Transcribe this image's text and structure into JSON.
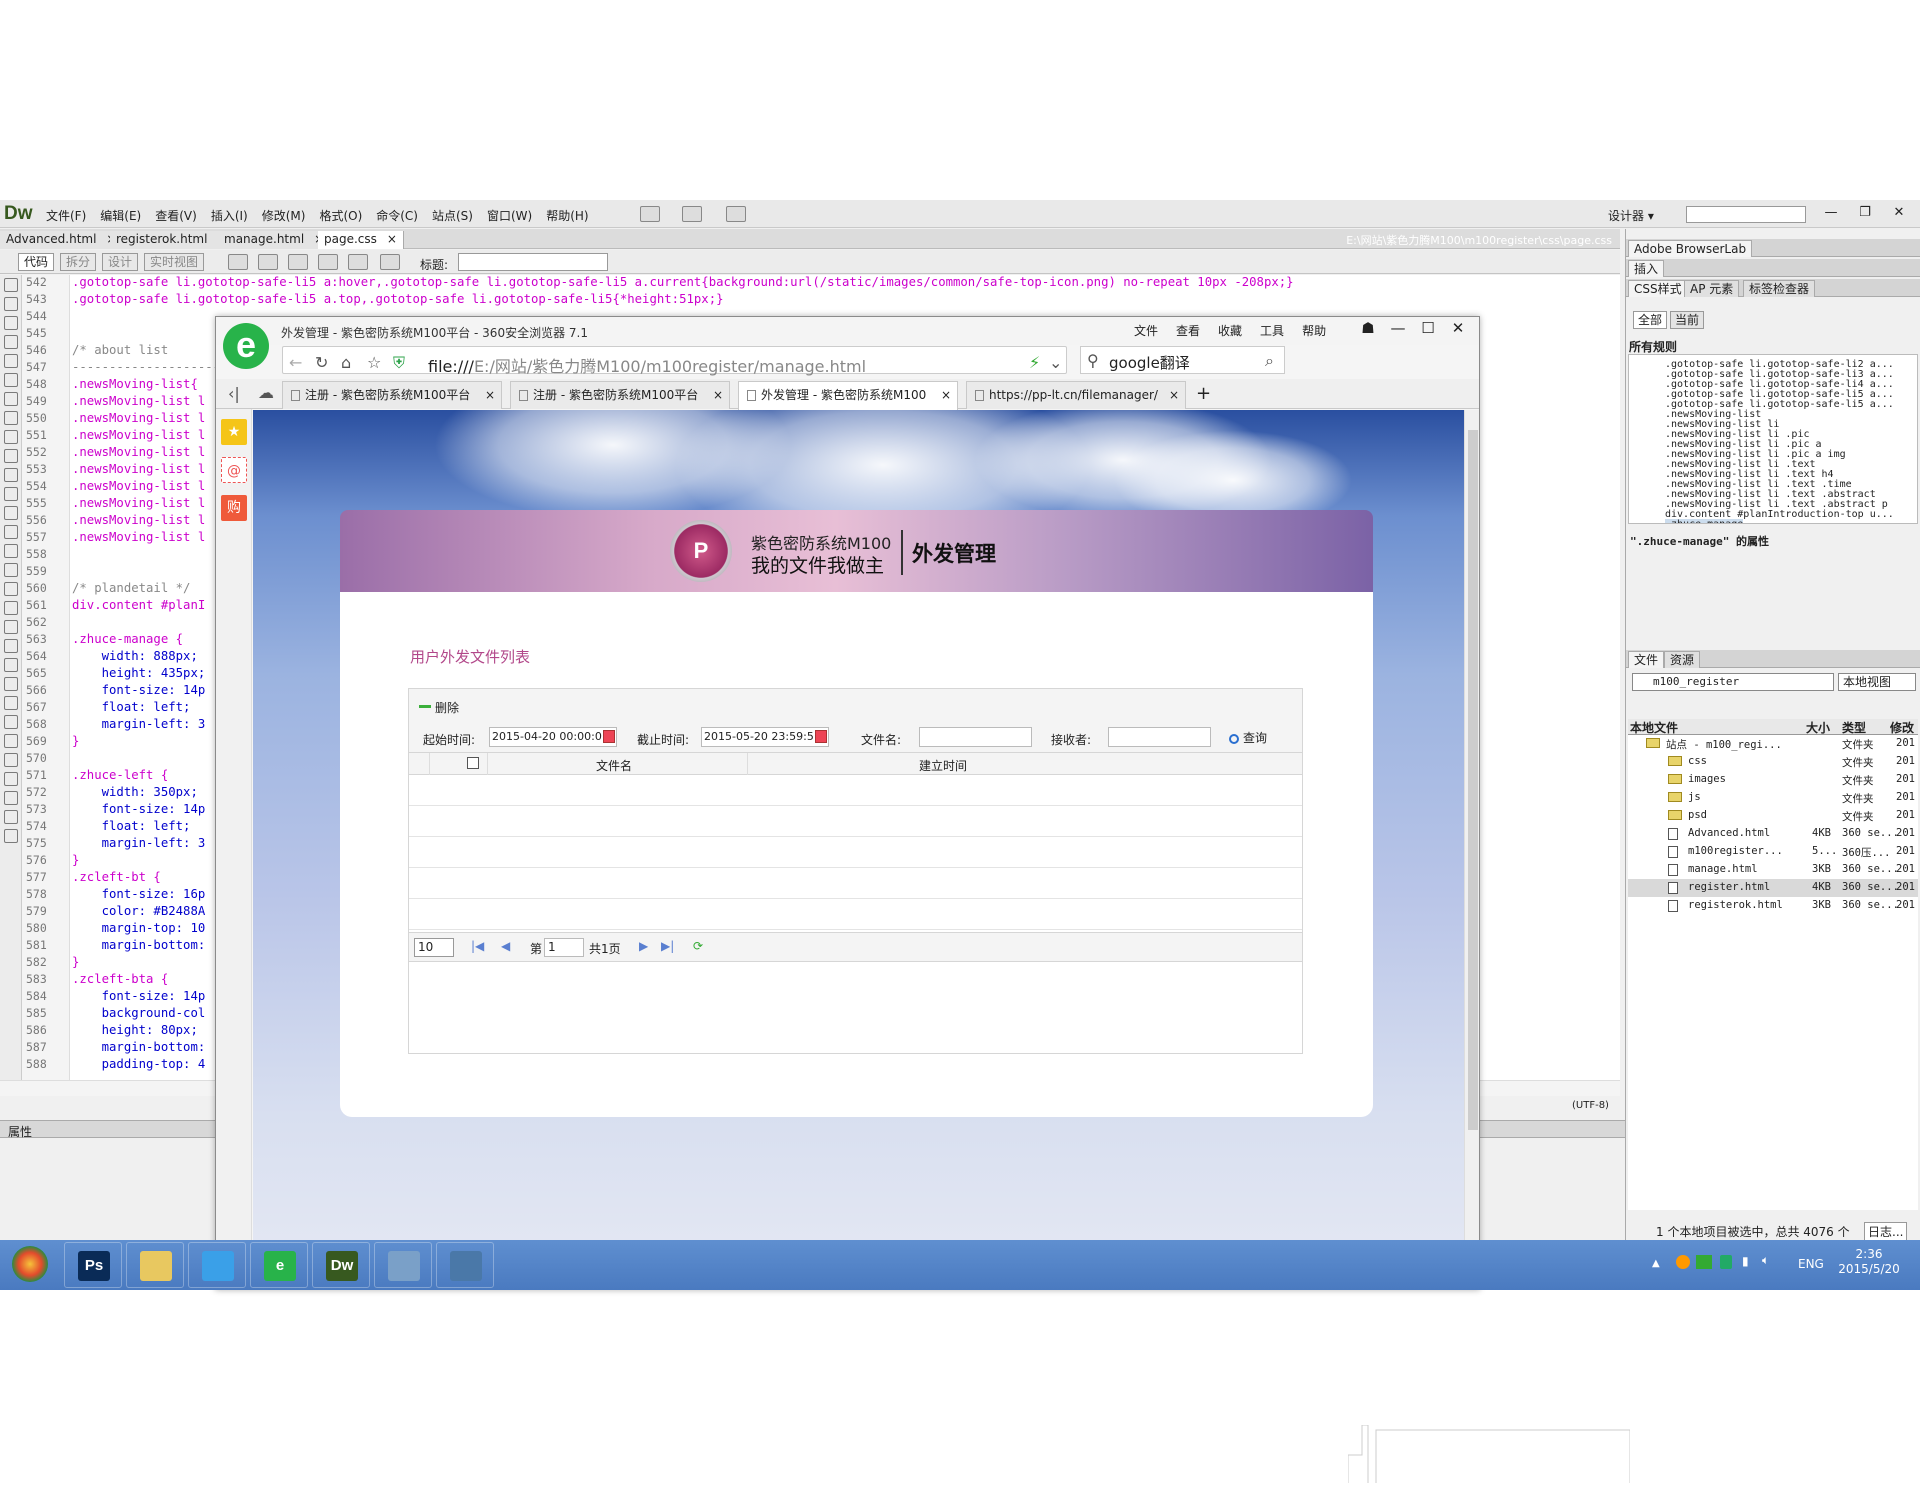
{
  "dw": {
    "logo": "Dw",
    "menus": [
      "文件(F)",
      "编辑(E)",
      "查看(V)",
      "插入(I)",
      "修改(M)",
      "格式(O)",
      "命令(C)",
      "站点(S)",
      "窗口(W)",
      "帮助(H)"
    ],
    "designer_label": "设计器 ▾",
    "doc_tabs": [
      "Advanced.html",
      "registerok.html",
      "manage.html",
      "page.css"
    ],
    "doc_close": "×",
    "path": "E:\\网站\\紫色力腾M100\\m100register\\css\\page.css",
    "view_buttons": [
      "代码",
      "拆分",
      "设计",
      "实时视图"
    ],
    "title_label": "标题:",
    "line_numbers": [
      "542",
      "543",
      "544",
      "545",
      "546",
      "547",
      "548",
      "549",
      "550",
      "551",
      "552",
      "553",
      "554",
      "555",
      "556",
      "557",
      "558",
      "559",
      "560",
      "561",
      "562",
      "563",
      "564",
      "565",
      "566",
      "567",
      "568",
      "569",
      "570",
      "571",
      "572",
      "573",
      "574",
      "575",
      "576",
      "577",
      "578",
      "579",
      "580",
      "581",
      "582",
      "583",
      "584",
      "585",
      "586",
      "587",
      "588"
    ],
    "code": [
      ".gototop-safe li.gototop-safe-li5 a:hover,.gototop-safe li.gototop-safe-li5 a.current{background:url(/static/images/common/safe-top-icon.png) no-repeat 10px -208px;}",
      ".gototop-safe li.gototop-safe-li5 a.top,.gototop-safe li.gototop-safe-li5{*height:51px;}",
      "",
      "",
      "/* about list",
      "------------------------",
      ".newsMoving-list{",
      ".newsMoving-list l",
      ".newsMoving-list l",
      ".newsMoving-list l",
      ".newsMoving-list l",
      ".newsMoving-list l",
      ".newsMoving-list l",
      ".newsMoving-list l",
      ".newsMoving-list l",
      ".newsMoving-list l",
      "",
      "",
      "/* plandetail */",
      "div.content #planI",
      "",
      ".zhuce-manage {",
      "    width: 888px;",
      "    height: 435px;",
      "    font-size: 14p",
      "    float: left;",
      "    margin-left: 3",
      "}",
      "",
      ".zhuce-left {",
      "    width: 350px;",
      "    font-size: 14p",
      "    float: left;",
      "    margin-left: 3",
      "}",
      ".zcleft-bt {",
      "    font-size: 16p",
      "    color: #B2488A",
      "    margin-top: 10",
      "    margin-bottom:",
      "}",
      ".zcleft-bta {",
      "    font-size: 14p",
      "    background-col",
      "    height: 80px;",
      "    margin-bottom:",
      "    padding-top: 4"
    ],
    "props_label": "属性",
    "encoding": "(UTF-8)"
  },
  "right_panel": {
    "browserlab": "Adobe BrowserLab",
    "insert_tab": "插入",
    "css_tabs": [
      "CSS样式",
      "AP 元素",
      "标签检查器"
    ],
    "btn_all": "全部",
    "btn_current": "当前",
    "all_rules": "所有规则",
    "rules": [
      ".gototop-safe li.gototop-safe-li2 a...",
      ".gototop-safe li.gototop-safe-li3 a...",
      ".gototop-safe li.gototop-safe-li4 a...",
      ".gototop-safe li.gototop-safe-li5 a...",
      ".gototop-safe li.gototop-safe-li5 a...",
      ".newsMoving-list",
      ".newsMoving-list li",
      ".newsMoving-list li .pic",
      ".newsMoving-list li .pic a",
      ".newsMoving-list li .pic a img",
      ".newsMoving-list li .text",
      ".newsMoving-list li .text h4",
      ".newsMoving-list li .text .time",
      ".newsMoving-list li .text .abstract",
      ".newsMoving-list li .text .abstract p",
      "div.content #planIntroduction-top u...",
      ".zhuce-manage"
    ],
    "props_of": "\".zhuce-manage\" 的属性",
    "files_tabs": [
      "文件",
      "资源"
    ],
    "site_name": "m100_register",
    "view_mode": "本地视图",
    "files_columns": [
      "本地文件",
      "大小",
      "类型",
      "修改"
    ],
    "files": [
      {
        "name": "站点 - m100_regi...",
        "size": "",
        "type": "文件夹",
        "mod": "201",
        "kind": "folder",
        "indent": 0
      },
      {
        "name": "css",
        "size": "",
        "type": "文件夹",
        "mod": "201",
        "kind": "folder",
        "indent": 1
      },
      {
        "name": "images",
        "size": "",
        "type": "文件夹",
        "mod": "201",
        "kind": "folder",
        "indent": 1
      },
      {
        "name": "js",
        "size": "",
        "type": "文件夹",
        "mod": "201",
        "kind": "folder",
        "indent": 1
      },
      {
        "name": "psd",
        "size": "",
        "type": "文件夹",
        "mod": "201",
        "kind": "folder",
        "indent": 1
      },
      {
        "name": "Advanced.html",
        "size": "4KB",
        "type": "360 se...",
        "mod": "201",
        "kind": "file",
        "indent": 1
      },
      {
        "name": "m100register...",
        "size": "5...",
        "type": "360压...",
        "mod": "201",
        "kind": "file",
        "indent": 1
      },
      {
        "name": "manage.html",
        "size": "3KB",
        "type": "360 se...",
        "mod": "201",
        "kind": "file",
        "indent": 1
      },
      {
        "name": "register.html",
        "size": "4KB",
        "type": "360 se...",
        "mod": "201",
        "kind": "file",
        "indent": 1,
        "selected": true
      },
      {
        "name": "registerok.html",
        "size": "3KB",
        "type": "360 se...",
        "mod": "201",
        "kind": "file",
        "indent": 1
      }
    ],
    "status": "1 个本地项目被选中，总共 4076 个",
    "log_btn": "日志..."
  },
  "browser": {
    "logo": "e",
    "title": "外发管理 - 紫色密防系统M100平台 - 360安全浏览器 7.1",
    "menus": [
      "文件",
      "查看",
      "收藏",
      "工具",
      "帮助"
    ],
    "address_prefix": "file:///",
    "address_rest": "E:/网站/紫色力腾M100/m100register/manage.html",
    "search_text": "google翻译",
    "tabs": [
      "注册 - 紫色密防系统M100平台",
      "注册 - 紫色密防系统M100平台",
      "外发管理 - 紫色密防系统M100",
      "https://pp-lt.cn/filemanager/"
    ],
    "active_tab": 2,
    "tab_close": "×",
    "new_tab": "+"
  },
  "page": {
    "brand_line1": "紫色密防系统M100",
    "brand_line2": "我的文件我做主",
    "brand_section": "外发管理",
    "list_title": "用户外发文件列表",
    "delete_btn": "删除",
    "start_label": "起始时间:",
    "start_value": "2015-04-20 00:00:0",
    "end_label": "截止时间:",
    "end_value": "2015-05-20 23:59:5",
    "filename_label": "文件名:",
    "receiver_label": "接收者:",
    "query_btn": "查询",
    "col_filename": "文件名",
    "col_created": "建立时间",
    "page_size": "10",
    "page_prefix": "第",
    "page_current": "1",
    "page_total": "共1页"
  },
  "taskbar": {
    "apps": [
      "Ps",
      "",
      "",
      "e",
      "Dw",
      "",
      ""
    ],
    "lang": "ENG",
    "time": "2:36",
    "date": "2015/5/20"
  },
  "colors": {
    "accent_title": "#B2488A",
    "dw_green": "#37591f",
    "browser_green": "#28b34a"
  }
}
